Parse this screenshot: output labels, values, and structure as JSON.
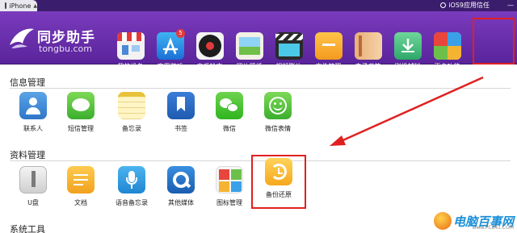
{
  "top_bar": {
    "device_label": "iPhone",
    "trust_label": "iOS9应用信任",
    "window_controls": "—"
  },
  "logo": {
    "name": "同步助手",
    "domain": "tongbu.com"
  },
  "nav": {
    "items": [
      {
        "label": "我的设备",
        "icon": "store-icon"
      },
      {
        "label": "应用游戏",
        "icon": "app-store-icon",
        "badge": "5"
      },
      {
        "label": "音乐铃声",
        "icon": "music-disc-icon"
      },
      {
        "label": "照片壁纸",
        "icon": "photo-icon"
      },
      {
        "label": "视频影片",
        "icon": "clapperboard-icon"
      },
      {
        "label": "文件管理",
        "icon": "folder-icon"
      },
      {
        "label": "电子书籍",
        "icon": "book-icon"
      },
      {
        "label": "刷机越狱",
        "icon": "jailbreak-icon"
      },
      {
        "label": "更多功能",
        "icon": "more-tiles-icon"
      }
    ]
  },
  "sections": {
    "info": {
      "title": "信息管理",
      "items": [
        {
          "label": "联系人",
          "icon": "contacts-icon"
        },
        {
          "label": "短信管理",
          "icon": "sms-icon"
        },
        {
          "label": "备忘录",
          "icon": "notes-icon"
        },
        {
          "label": "书签",
          "icon": "bookmark-icon"
        },
        {
          "label": "微信",
          "icon": "wechat-icon"
        },
        {
          "label": "微信表情",
          "icon": "emoji-icon"
        }
      ]
    },
    "data": {
      "title": "资料管理",
      "items": [
        {
          "label": "U盘",
          "icon": "usb-drive-icon"
        },
        {
          "label": "文档",
          "icon": "document-icon"
        },
        {
          "label": "语音备忘录",
          "icon": "microphone-icon"
        },
        {
          "label": "其他媒体",
          "icon": "quicktime-icon"
        },
        {
          "label": "图标管理",
          "icon": "icon-grid-icon"
        },
        {
          "label": "备份还原",
          "icon": "backup-restore-icon"
        }
      ]
    },
    "tools": {
      "title": "系统工具"
    }
  },
  "watermark": {
    "text": "电脑百事网",
    "url": "www.PC841.COM"
  },
  "colors": {
    "header": "#6a2fae",
    "highlight": "#e02020"
  }
}
